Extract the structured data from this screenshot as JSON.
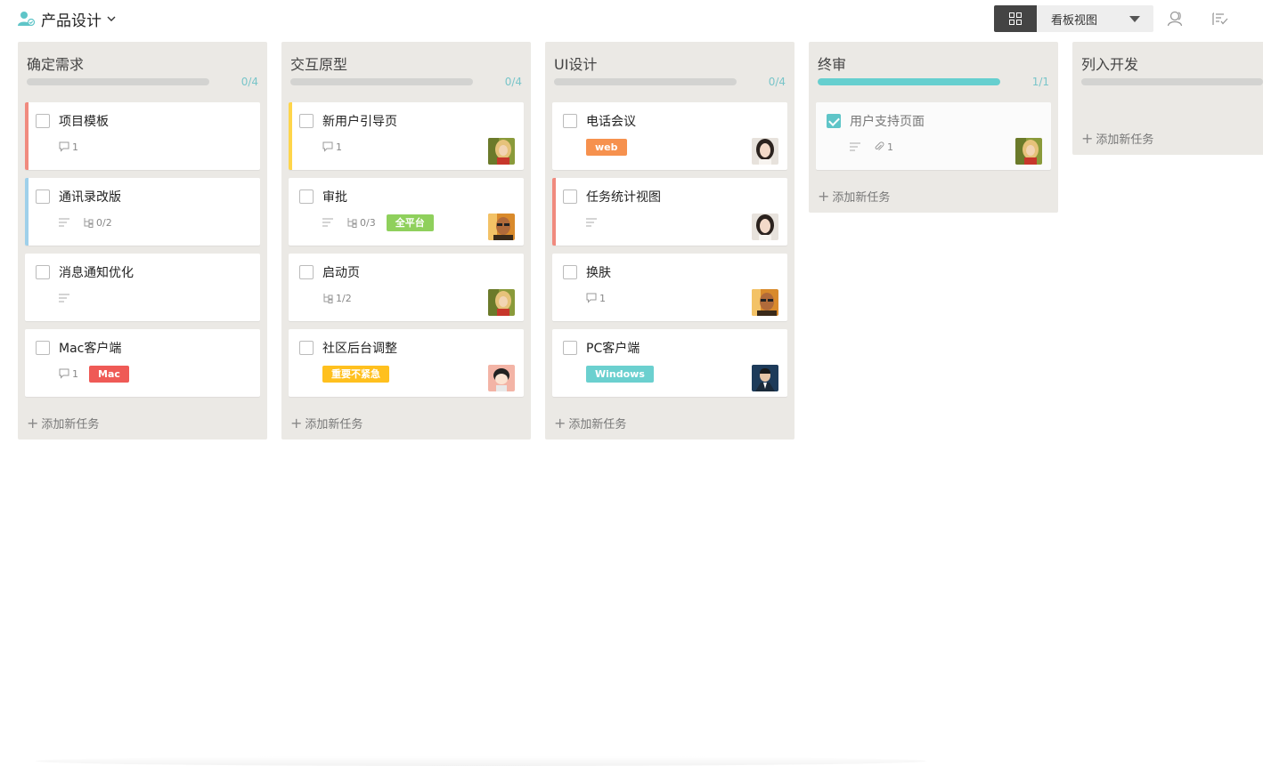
{
  "header": {
    "project_title": "产品设计",
    "view_label": "看板视图",
    "icons": [
      "project-member-icon",
      "chevron-down-icon",
      "grid-icon",
      "caret-down-icon",
      "members-icon",
      "filter-list-icon"
    ]
  },
  "columns": [
    {
      "title": "确定需求",
      "count": "0/4",
      "progress": 0,
      "add_label": "添加新任务",
      "cards": [
        {
          "title": "项目模板",
          "bar_color": "#f08a7e",
          "comments": "1"
        },
        {
          "title": "通讯录改版",
          "bar_color": "#9fd0ea",
          "subtasks": "0/2"
        },
        {
          "title": "消息通知优化"
        },
        {
          "title": "Mac客户端",
          "comments": "1",
          "tag": "Mac",
          "tag_color": "#ef5a56"
        }
      ]
    },
    {
      "title": "交互原型",
      "count": "0/4",
      "progress": 0,
      "add_label": "添加新任务",
      "cards": [
        {
          "title": "新用户引导页",
          "bar_color": "#ffd54a",
          "comments": "1",
          "avatar": "avatar-blonde"
        },
        {
          "title": "审批",
          "subtasks": "0/3",
          "tag": "全平台",
          "tag_color": "#8fd05c",
          "avatar": "avatar-man-glasses"
        },
        {
          "title": "启动页",
          "subtasks": "1/2",
          "avatar": "avatar-blonde"
        },
        {
          "title": "社区后台调整",
          "tag": "重要不紧急",
          "tag_color": "#ffc01e",
          "avatar": "avatar-cartoon"
        }
      ]
    },
    {
      "title": "UI设计",
      "count": "0/4",
      "progress": 0,
      "add_label": "添加新任务",
      "cards": [
        {
          "title": "电话会议",
          "tag": "web",
          "tag_color": "#f6914e",
          "avatar": "avatar-woman"
        },
        {
          "title": "任务统计视图",
          "bar_color": "#f08a7e",
          "avatar": "avatar-woman"
        },
        {
          "title": "换肤",
          "comments": "1",
          "avatar": "avatar-man-glasses"
        },
        {
          "title": "PC客户端",
          "tag": "Windows",
          "tag_color": "#6bd0cf",
          "avatar": "avatar-man-suit"
        }
      ]
    },
    {
      "title": "终审",
      "count": "1/1",
      "progress": 1,
      "add_label": "添加新任务",
      "cards": [
        {
          "title": "用户支持页面",
          "done": true,
          "attachments": "1",
          "avatar": "avatar-blonde"
        }
      ]
    },
    {
      "title": "列入开发",
      "add_label": "添加新任务",
      "cards": []
    }
  ],
  "colors": {
    "accent": "#5fc5c8",
    "column_bg": "#ebe9e5",
    "header_dark": "#444444"
  }
}
